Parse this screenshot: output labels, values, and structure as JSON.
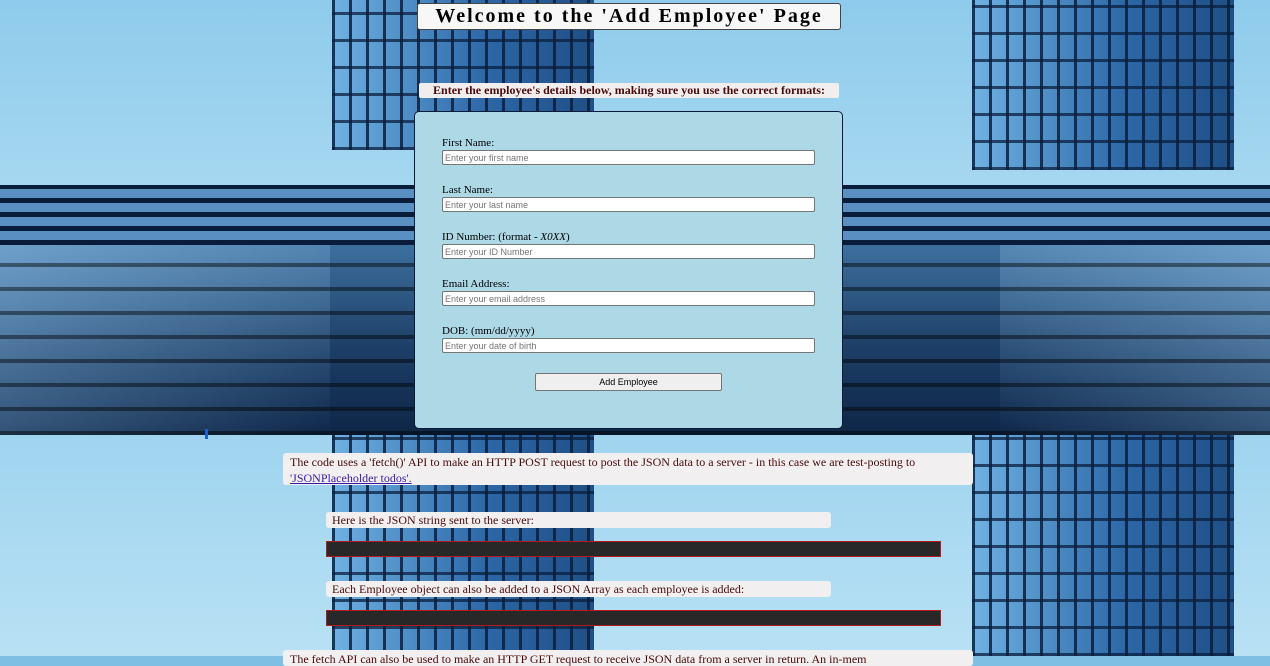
{
  "page": {
    "title": "Welcome to the 'Add Employee' Page",
    "instructions": "Enter the employee's details below, making sure you use the correct formats:"
  },
  "form": {
    "first_name": {
      "label": "First Name:",
      "placeholder": "Enter your first name",
      "value": ""
    },
    "last_name": {
      "label": "Last Name:",
      "placeholder": "Enter your last name",
      "value": ""
    },
    "id_number": {
      "label": "ID Number: (format - ",
      "format_hint": "X0XX",
      "label_close": ")",
      "placeholder": "Enter your ID Number",
      "value": ""
    },
    "email": {
      "label": "Email Address:",
      "placeholder": "Enter your email address",
      "value": ""
    },
    "dob": {
      "label": "DOB: (mm/dd/yyyy)",
      "placeholder": "Enter your date of birth",
      "value": ""
    },
    "submit_label": "Add Employee"
  },
  "info": {
    "fetch_text": "The code uses a 'fetch()' API to make an HTTP POST request to post the JSON data to a server - in this case we are test-posting to ",
    "fetch_link": "'JSONPlaceholder todos'.",
    "json_string_label": "Here is the JSON string sent to the server:",
    "json_string_output": "",
    "json_array_label": "Each Employee object can also be added to a JSON Array as each employee is added:",
    "json_array_output": "",
    "cutoff_text": "The fetch API can also be used to make an HTTP GET request to receive JSON data from a server in return. An in-mem"
  },
  "colors": {
    "form_bg": "#add8e6",
    "text_dark_red": "#4a0a0a",
    "code_bg": "#282828",
    "code_border": "#b31b1b",
    "link": "#3c1aa8"
  }
}
